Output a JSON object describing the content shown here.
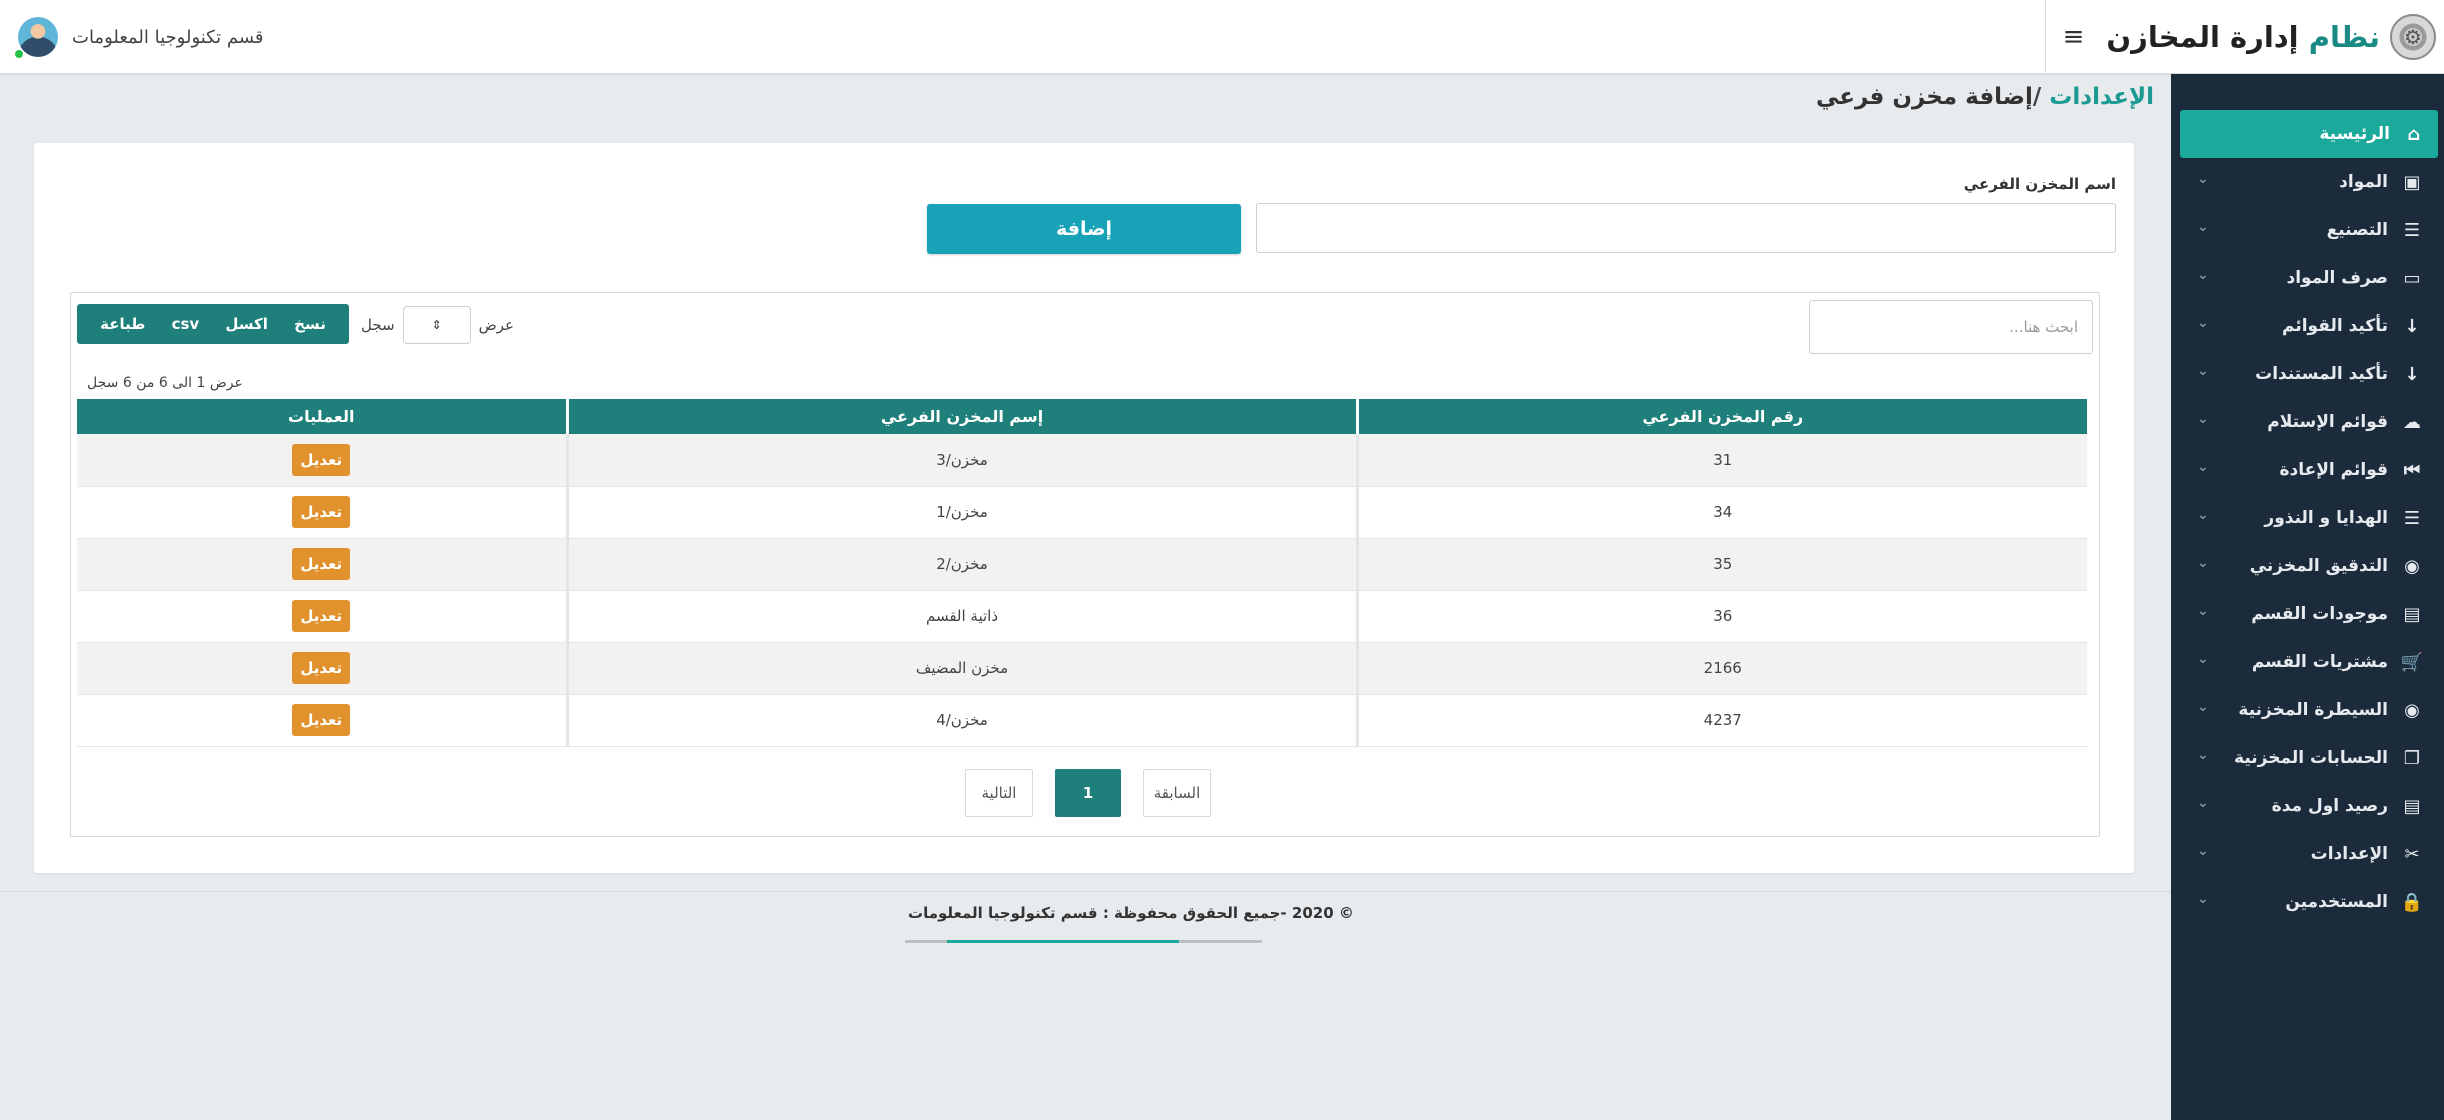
{
  "header": {
    "brand_accent": "نظام",
    "brand_main": "إدارة المخازن",
    "menu_icon": "hamburger-icon",
    "user_name": "قسم تكنولوجيا المعلومات"
  },
  "sidebar": {
    "items": [
      {
        "label": "الرئيسية",
        "icon": "home-icon",
        "active": true
      },
      {
        "label": "المواد",
        "icon": "box-icon"
      },
      {
        "label": "التصنيع",
        "icon": "list-icon"
      },
      {
        "label": "صرف المواد",
        "icon": "briefcase-icon"
      },
      {
        "label": "تأكيد القوائم",
        "icon": "download-icon"
      },
      {
        "label": "تأكيد المستندات",
        "icon": "download-icon"
      },
      {
        "label": "قوائم الإستلام",
        "icon": "cloud-upload-icon"
      },
      {
        "label": "قوائم الإعادة",
        "icon": "backward-icon"
      },
      {
        "label": "الهدايا و النذور",
        "icon": "list-icon"
      },
      {
        "label": "التدقيق المخزني",
        "icon": "eye-icon"
      },
      {
        "label": "موجودات القسم",
        "icon": "book-icon"
      },
      {
        "label": "مشتريات القسم",
        "icon": "cart-icon"
      },
      {
        "label": "السيطرة المخزنية",
        "icon": "eye-icon"
      },
      {
        "label": "الحسابات المخزنية",
        "icon": "copy-icon"
      },
      {
        "label": "رصيد اول مدة",
        "icon": "book-icon"
      },
      {
        "label": "الإعدادات",
        "icon": "tools-icon"
      },
      {
        "label": "المستخدمين",
        "icon": "lock-icon"
      }
    ]
  },
  "breadcrumb": {
    "root": "الإعدادات",
    "separator": " /",
    "current": "إضافة مخزن فرعي"
  },
  "form": {
    "label": "اسم المخزن الفرعي",
    "value": "",
    "add_button": "إضافة"
  },
  "table_controls": {
    "search_placeholder": "ابحث هنا...",
    "show_label": "عرض",
    "records_label": "سجل",
    "buttons": [
      "نسخ",
      "اكسل",
      "csv",
      "طباعة"
    ],
    "info": "عرض 1 الى 6 من 6 سجل"
  },
  "table": {
    "headers": [
      "رقم المخزن الفرعي",
      "إسم المخزن الفرعي",
      "العمليات"
    ],
    "edit_label": "تعديل",
    "rows": [
      {
        "id": "31",
        "name": "مخزن/3"
      },
      {
        "id": "34",
        "name": "مخزن/1"
      },
      {
        "id": "35",
        "name": "مخزن/2"
      },
      {
        "id": "36",
        "name": "ذاتية القسم"
      },
      {
        "id": "2166",
        "name": "مخزن المضيف"
      },
      {
        "id": "4237",
        "name": "مخزن/4"
      }
    ]
  },
  "pagination": {
    "prev": "السابقة",
    "current": "1",
    "next": "التالية"
  },
  "footer": {
    "text": "© 2020 -جميع الحقوق محفوظة : قسم تكنولوجيا المعلومات"
  },
  "colors": {
    "sidebar_bg": "#1b2b3c",
    "accent": "#1aa99b",
    "table_header": "#1f7f7b",
    "add_button": "#17a2b8",
    "edit_button": "#e2922d"
  }
}
